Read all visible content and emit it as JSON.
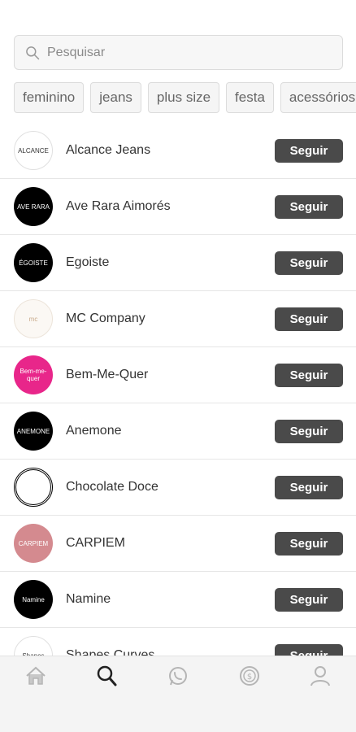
{
  "search": {
    "placeholder": "Pesquisar"
  },
  "chips": [
    "feminino",
    "jeans",
    "plus size",
    "festa",
    "acessórios"
  ],
  "stores": [
    {
      "name": "Alcance Jeans",
      "logo_text": "ALCANCE",
      "logo_style": "white"
    },
    {
      "name": "Ave Rara Aimorés",
      "logo_text": "AVE RARA",
      "logo_style": "black"
    },
    {
      "name": "Egoiste",
      "logo_text": "ÉGOISTE",
      "logo_style": "black"
    },
    {
      "name": "MC Company",
      "logo_text": "mc",
      "logo_style": "cream"
    },
    {
      "name": "Bem-Me-Quer",
      "logo_text": "Bem-me-quer",
      "logo_style": "pink"
    },
    {
      "name": "Anemone",
      "logo_text": "ANEMONE",
      "logo_style": "black"
    },
    {
      "name": "Chocolate Doce",
      "logo_text": "",
      "logo_style": "badge"
    },
    {
      "name": "CARPIEM",
      "logo_text": "CARPIEM",
      "logo_style": "rose"
    },
    {
      "name": "Namine",
      "logo_text": "Namine",
      "logo_style": "black"
    },
    {
      "name": "Shapes Curves",
      "logo_text": "Shapes",
      "logo_style": "white"
    }
  ],
  "follow_label": "Seguir",
  "tabs": [
    "home-icon",
    "search-icon",
    "whatsapp-icon",
    "cashback-icon",
    "profile-icon"
  ],
  "colors": {
    "button": "#4a4a4a",
    "pink": "#e8268a",
    "active_tab": "#222222",
    "inactive_tab": "#b5b5b5"
  }
}
